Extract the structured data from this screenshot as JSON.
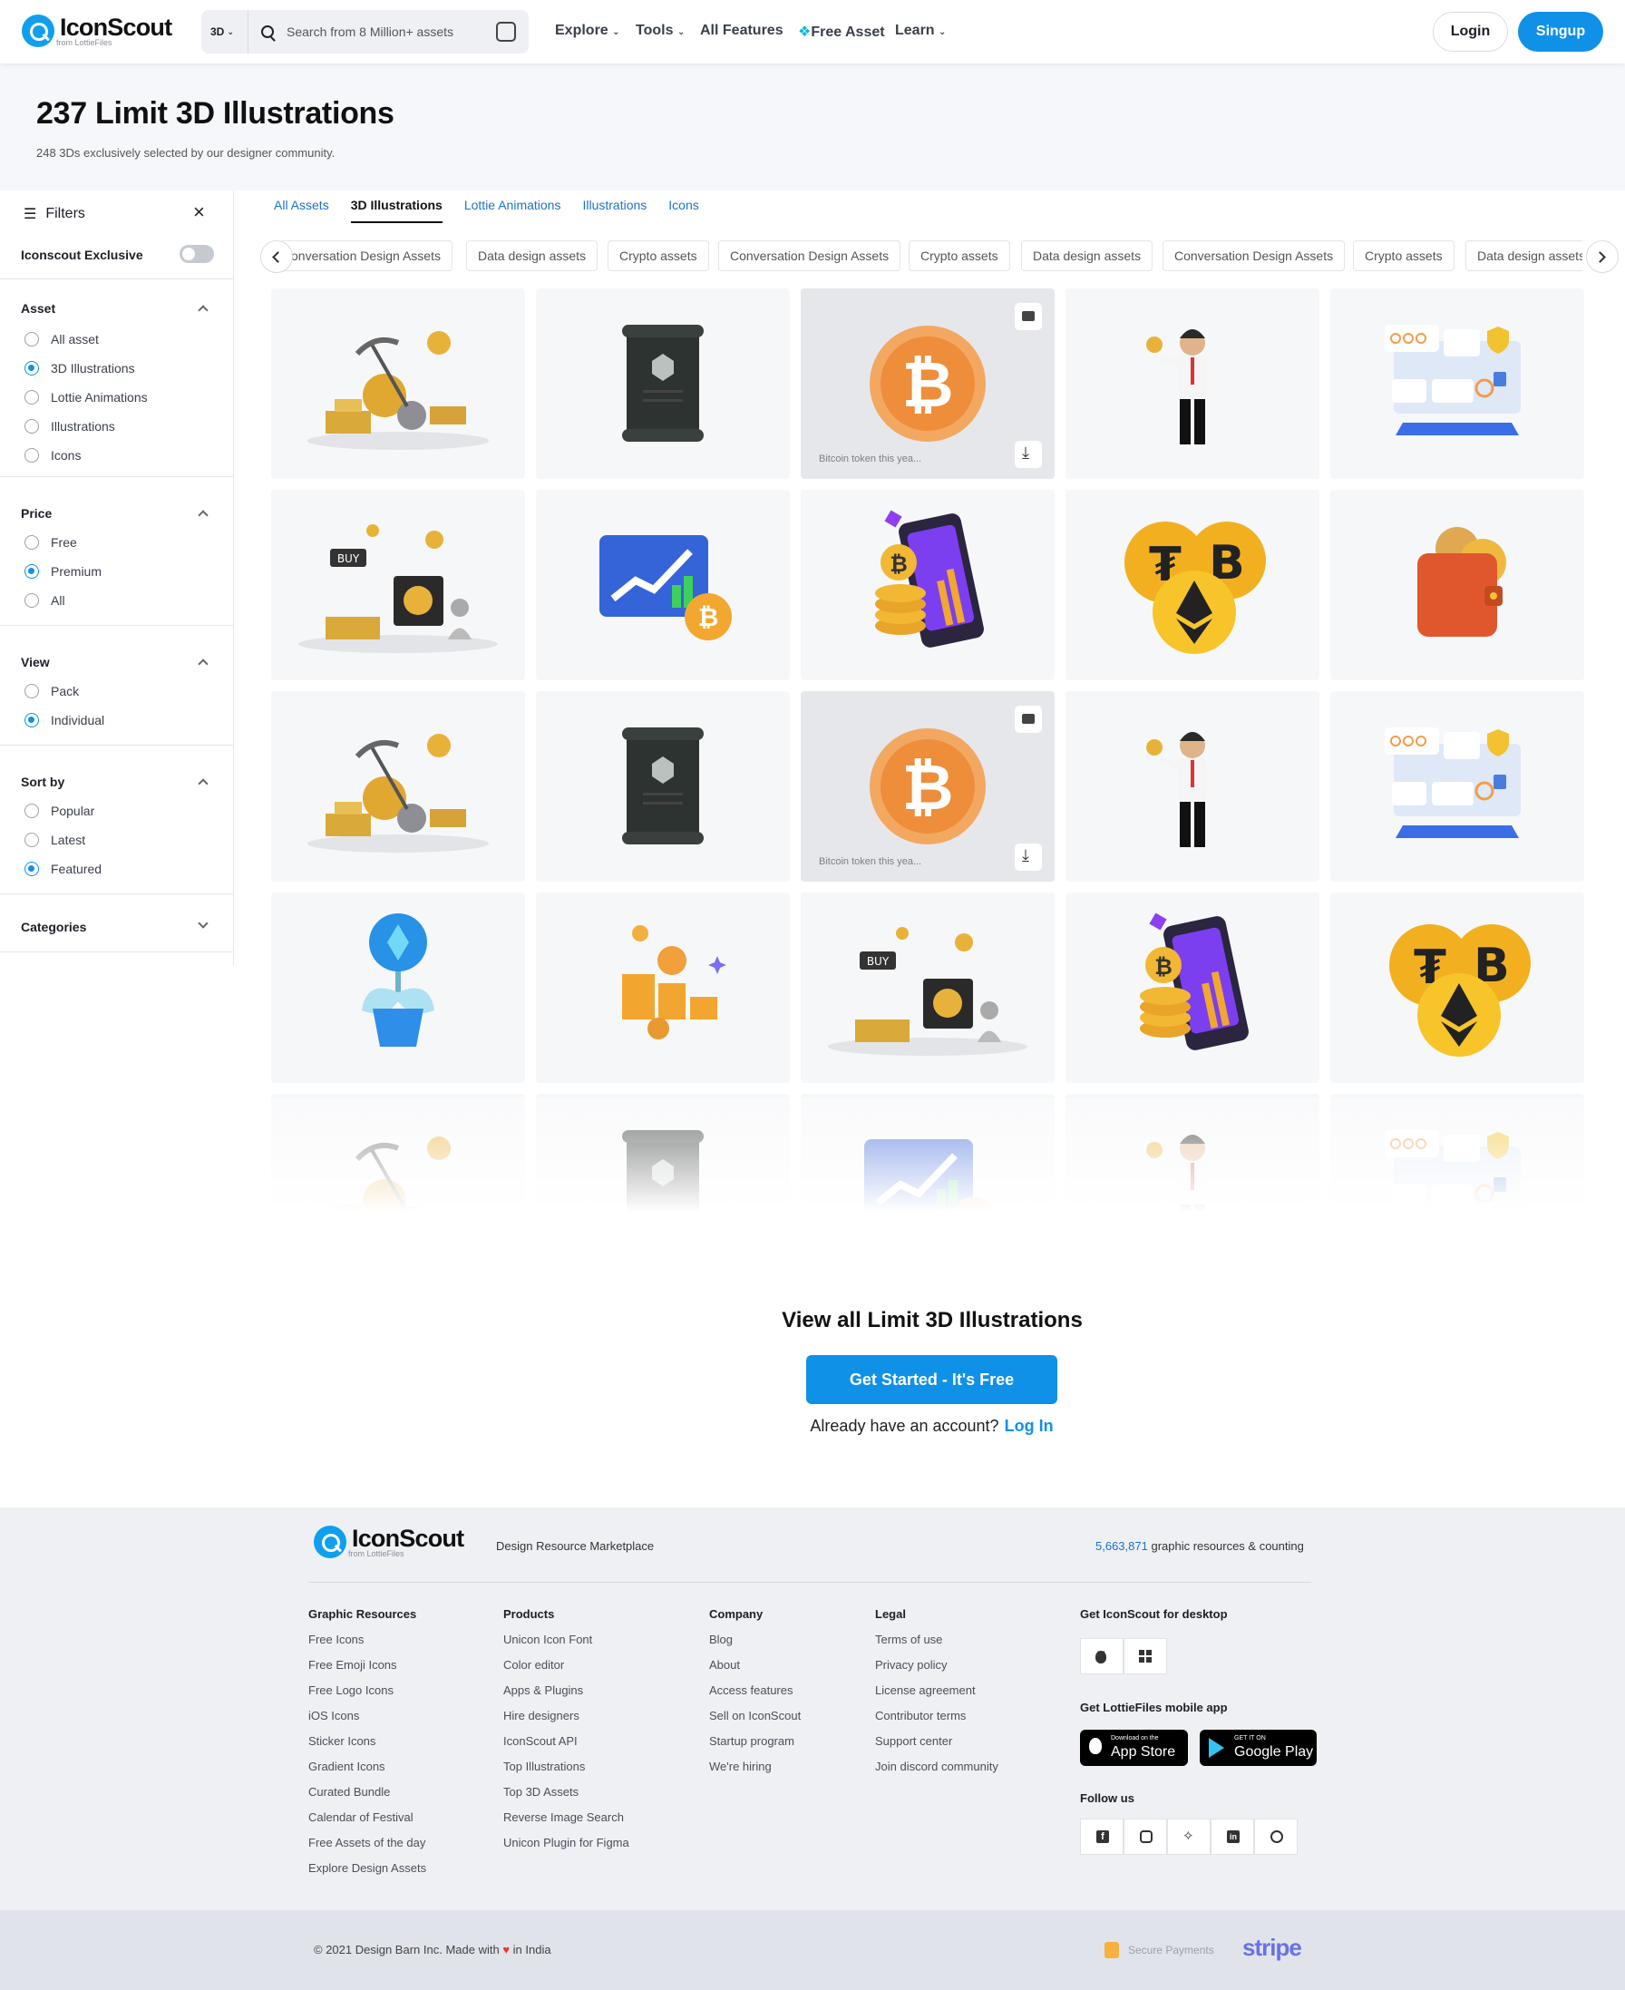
{
  "brand": {
    "name": "IconScout",
    "sub": "from LottieFiles"
  },
  "search": {
    "type": "3D",
    "placeholder": "Search from 8 Million+ assets"
  },
  "nav": {
    "explore": "Explore",
    "tools": "Tools",
    "features": "All Features",
    "free": "Free Asset",
    "learn": "Learn",
    "login": "Login",
    "signup": "Singup"
  },
  "page": {
    "title": "237 Limit 3D Illustrations",
    "subtitle": "248 3Ds exclusively selected by our designer community."
  },
  "filters": {
    "title": "Filters",
    "exclusive": "Iconscout Exclusive",
    "asset": {
      "title": "Asset",
      "options": [
        "All asset",
        "3D Illustrations",
        "Lottie Animations",
        "Illustrations",
        "Icons"
      ],
      "selected": 1
    },
    "price": {
      "title": "Price",
      "options": [
        "Free",
        "Premium",
        "All"
      ],
      "selected": 1
    },
    "view": {
      "title": "View",
      "options": [
        "Pack",
        "Individual"
      ],
      "selected": 1
    },
    "sort": {
      "title": "Sort by",
      "options": [
        "Popular",
        "Latest",
        "Featured"
      ],
      "selected": 2
    },
    "categories": "Categories"
  },
  "tabs": [
    "All Assets",
    "3D Illustrations",
    "Lottie Animations",
    "Illustrations",
    "Icons"
  ],
  "chips": [
    "onversation Design Assets",
    "Data design assets",
    "Crypto assets",
    "Conversation Design Assets",
    "Crypto assets",
    "Data design assets",
    "Conversation Design Assets",
    "Crypto assets",
    "Data design assets"
  ],
  "cards": {
    "caption": "Bitcoin token this yea..."
  },
  "cta": {
    "title": "View all Limit 3D Illustrations",
    "button": "Get Started - It's Free",
    "account": "Already have an account?",
    "login": "Log In"
  },
  "footer": {
    "tagline": "Design Resource Marketplace",
    "count": "5,663,871",
    "count_text": "graphic resources & counting",
    "cols": [
      {
        "title": "Graphic Resources",
        "links": [
          "Free Icons",
          "Free Emoji Icons",
          "Free Logo Icons",
          "iOS Icons",
          "Sticker Icons",
          "Gradient Icons",
          "Curated Bundle",
          "Calendar of Festival",
          "Free Assets of the day",
          "Explore Design Assets"
        ]
      },
      {
        "title": "Products",
        "links": [
          "Unicon Icon Font",
          "Color editor",
          "Apps & Plugins",
          "Hire designers",
          "IconScout API",
          "Top Illustrations",
          "Top 3D Assets",
          "Reverse Image Search",
          "Unicon Plugin for Figma"
        ]
      },
      {
        "title": "Company",
        "links": [
          "Blog",
          "About",
          "Access features",
          "Sell on IconScout",
          "Startup program",
          "We're hiring"
        ]
      },
      {
        "title": "Legal",
        "links": [
          "Terms of use",
          "Privacy policy",
          "License agreement",
          "Contributor terms",
          "Support center",
          "Join discord community"
        ]
      }
    ],
    "desktop": "Get IconScout for desktop",
    "mobile": "Get LottieFiles mobile app",
    "appstore_small": "Download on the",
    "appstore": "App Store",
    "play_small": "GET IT ON",
    "play": "Google Play",
    "follow": "Follow us",
    "copyright": "© 2021 Design Barn Inc. Made with",
    "in_india": "in India",
    "secure": "Secure Payments",
    "stripe": "stripe"
  }
}
